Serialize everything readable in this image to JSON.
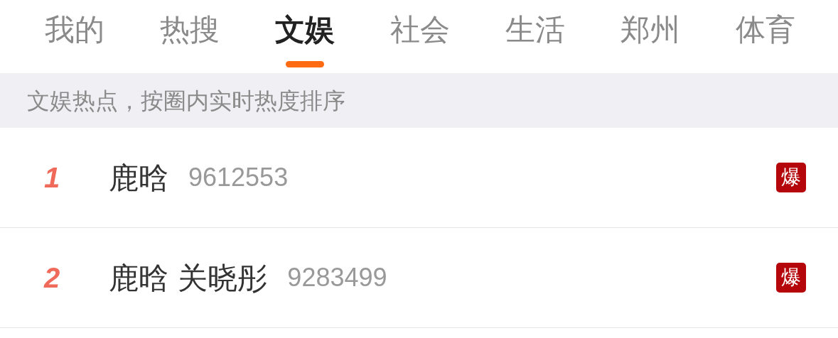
{
  "tabs": [
    {
      "label": "我的",
      "selected": false
    },
    {
      "label": "热搜",
      "selected": false
    },
    {
      "label": "文娱",
      "selected": true
    },
    {
      "label": "社会",
      "selected": false
    },
    {
      "label": "生活",
      "selected": false
    },
    {
      "label": "郑州",
      "selected": false
    },
    {
      "label": "体育",
      "selected": false
    }
  ],
  "banner": "文娱热点，按圈内实时热度排序",
  "items": [
    {
      "rank": "1",
      "title": "鹿晗",
      "count": "9612553",
      "badge": "爆"
    },
    {
      "rank": "2",
      "title": "鹿晗 关晓彤",
      "count": "9283499",
      "badge": "爆"
    }
  ]
}
